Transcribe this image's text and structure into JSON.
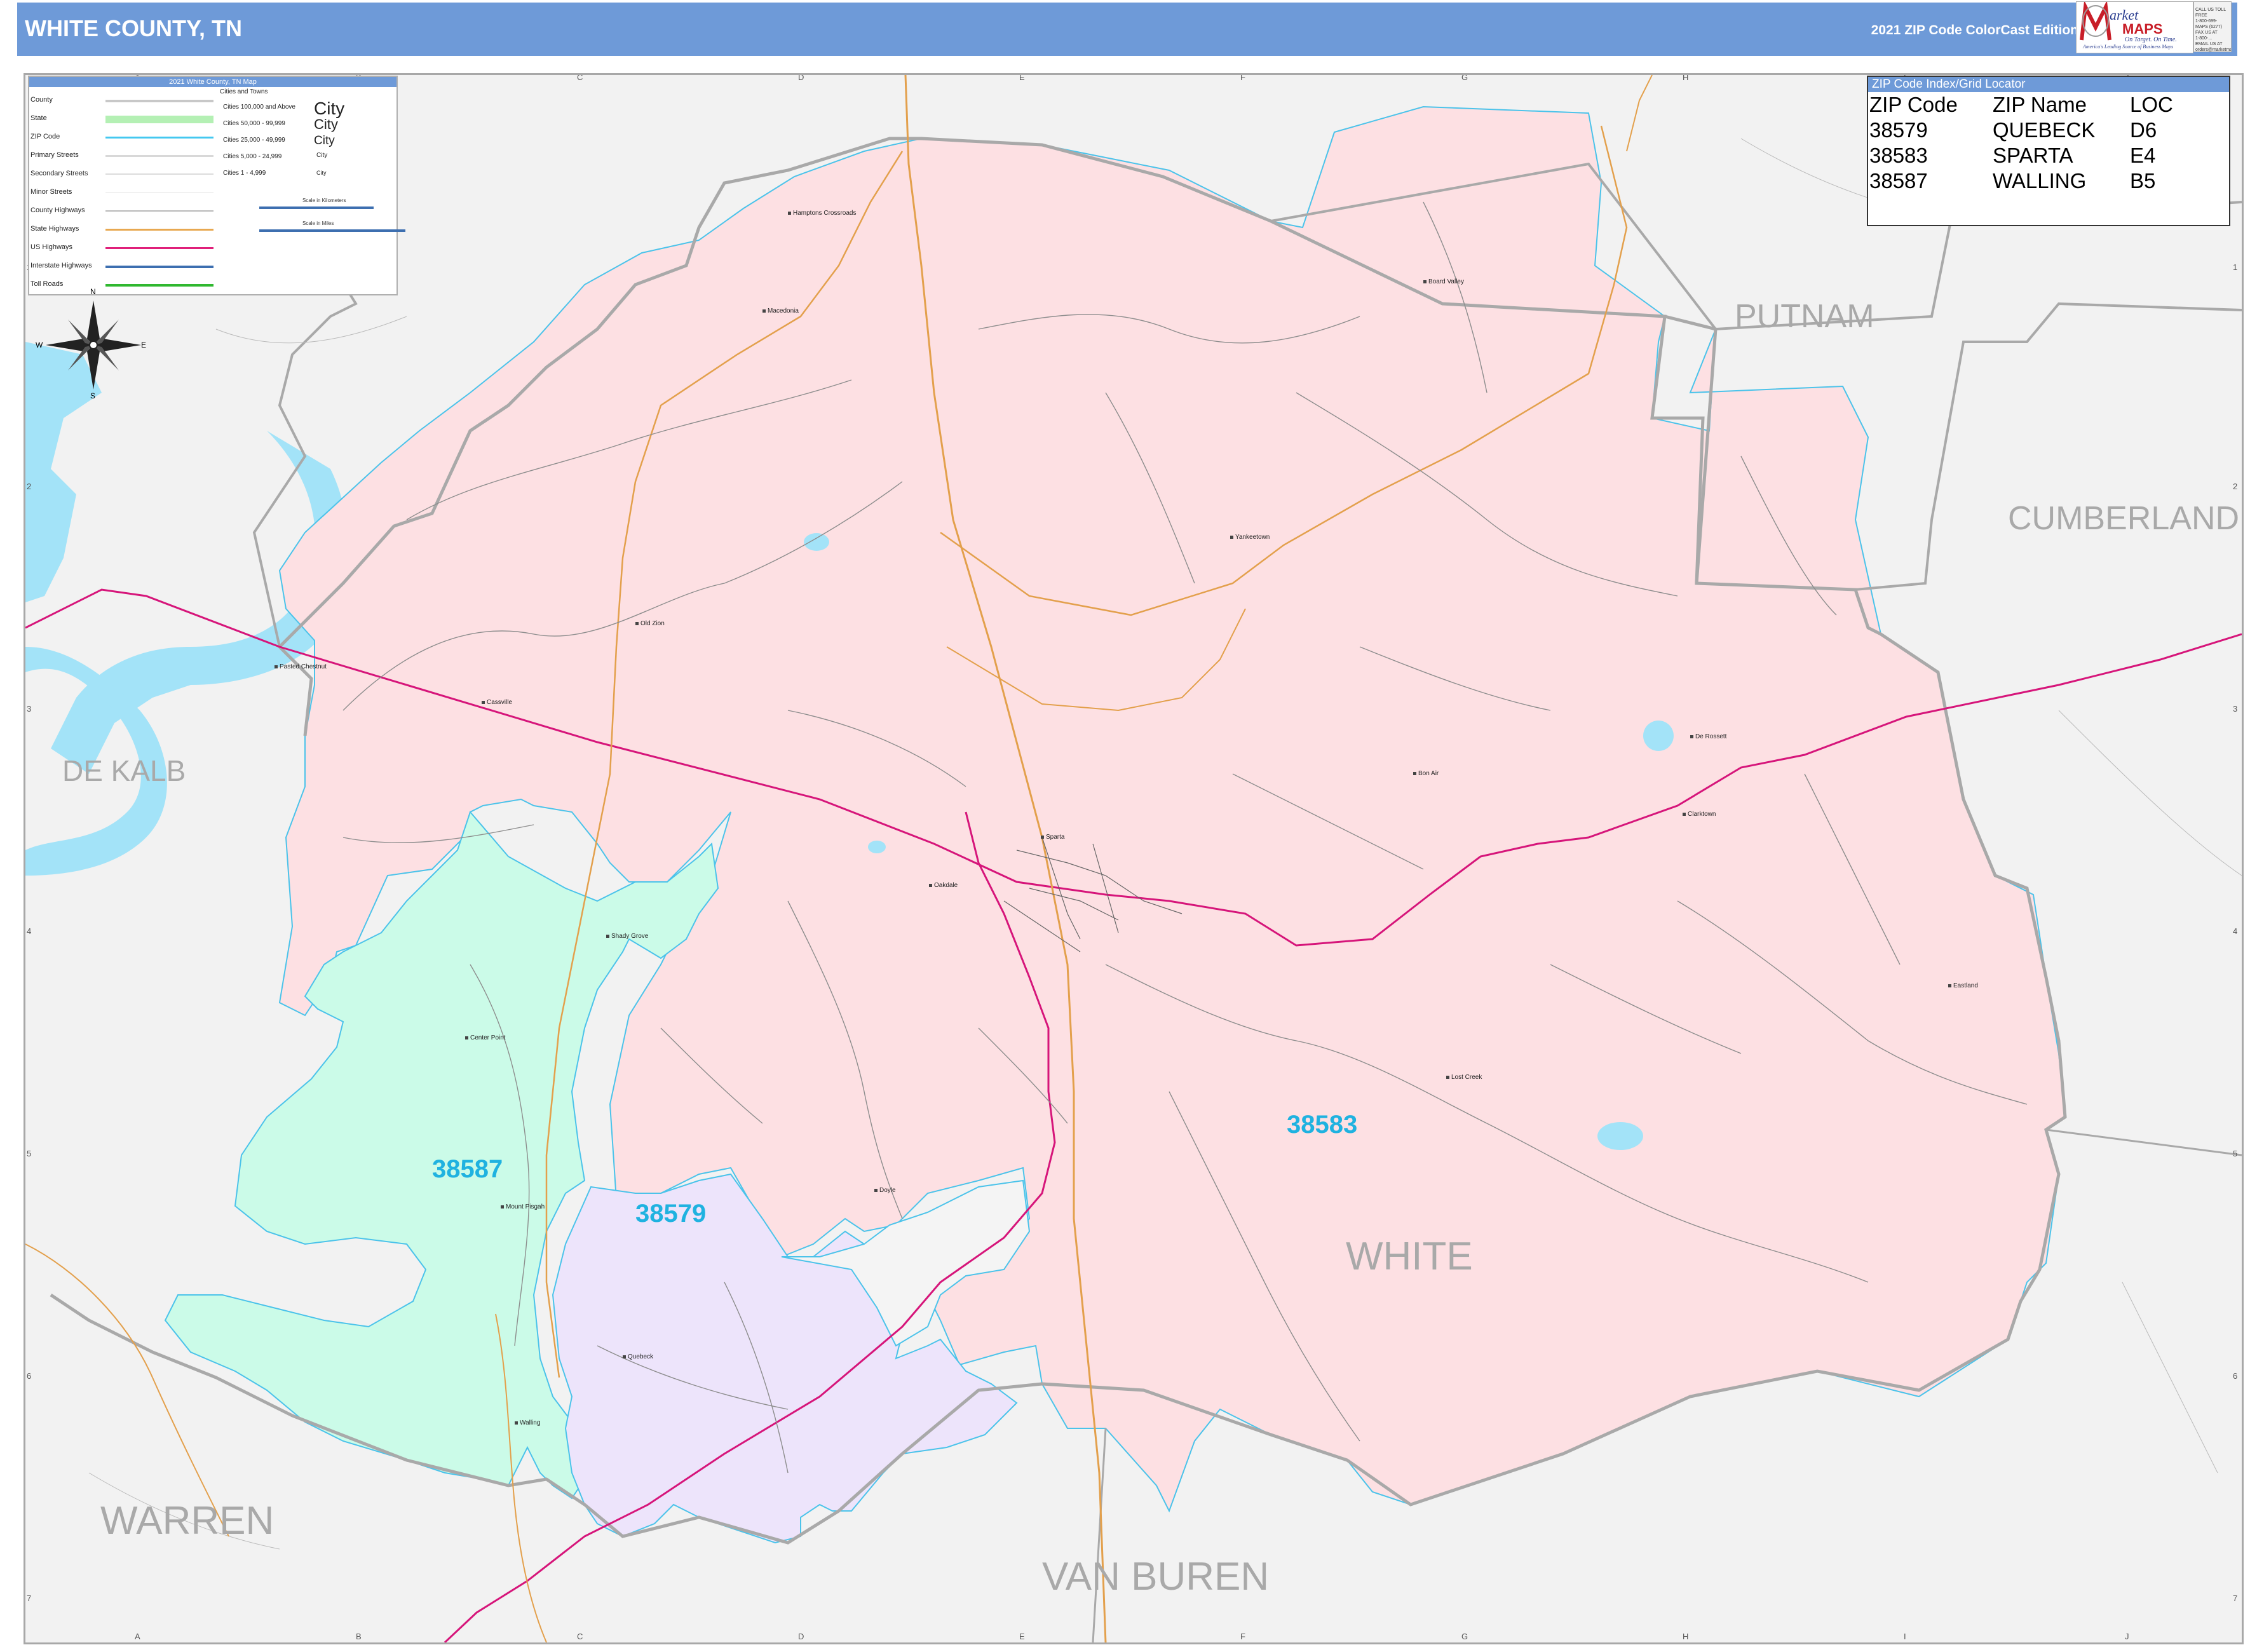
{
  "header": {
    "title": "WHITE COUNTY, TN",
    "edition": "2021 ZIP Code ColorCast Edition",
    "logo": {
      "word_market": "arket",
      "word_maps": "MAPS",
      "tagline": "On Target.  On Time.",
      "subtagline": "America's Leading Source of Business Maps",
      "contact_lines": [
        "CALL US TOLL FREE",
        "1-800-699-MAPS (6277)",
        "FAX US AT",
        "1-800-...",
        "EMAIL US AT",
        "orders@marketmaps.com"
      ]
    }
  },
  "grid": {
    "columns": [
      "A",
      "B",
      "C",
      "D",
      "E",
      "F",
      "G",
      "H",
      "I",
      "J"
    ],
    "rows": [
      "1",
      "2",
      "3",
      "4",
      "5",
      "6",
      "7"
    ]
  },
  "legend": {
    "title": "2021 White County, TN Map",
    "items": [
      {
        "label": "County",
        "color": "#c8c8c8"
      },
      {
        "label": "State",
        "color": "#b4f0b4"
      },
      {
        "label": "ZIP Code",
        "color": "#44c8f0"
      },
      {
        "label": "Primary Streets",
        "color": "#d8d8d8"
      },
      {
        "label": "Secondary Streets",
        "color": "#e4e4e4"
      },
      {
        "label": "Minor Streets",
        "color": "#eeeeee"
      },
      {
        "label": "County Highways",
        "color": "#b8b8b8"
      },
      {
        "label": "State Highways",
        "color": "#e8a850"
      },
      {
        "label": "US Highways",
        "color": "#e0207a"
      },
      {
        "label": "Interstate Highways",
        "color": "#3d6fb0"
      },
      {
        "label": "Toll Roads",
        "color": "#30b830"
      }
    ],
    "cities_heading": "Cities and Towns",
    "city_classes": [
      "Cities 100,000 and Above",
      "Cities 50,000 - 99,999",
      "Cities 25,000 - 49,999",
      "Cities 5,000 - 24,999",
      "Cities 1 - 4,999"
    ],
    "city_sample": "City",
    "scale_km_label": "Scale in Kilometers",
    "scale_mi_label": "Scale in Miles",
    "scale_km_ticks": [
      "0",
      "1",
      "2",
      "3"
    ],
    "scale_mi_ticks": [
      "0",
      "1",
      "2",
      "3"
    ]
  },
  "compass": {
    "n": "N",
    "s": "S",
    "e": "E",
    "w": "W"
  },
  "zip_index": {
    "title": "ZIP Code Index/Grid Locator",
    "columns": [
      "ZIP Code",
      "ZIP Name",
      "LOC"
    ],
    "rows": [
      [
        "38579",
        "QUEBECK",
        "D6"
      ],
      [
        "38583",
        "SPARTA",
        "E4"
      ],
      [
        "38587",
        "WALLING",
        "B5"
      ]
    ]
  },
  "counties": [
    "PUTNAM",
    "CUMBERLAND",
    "DE KALB",
    "WARREN",
    "VAN BUREN",
    "WHITE"
  ],
  "zip_labels": [
    "38583",
    "38587",
    "38579"
  ],
  "places": [
    "Hamptons Crossroads",
    "Board Valley",
    "Macedonia",
    "Yankeetown",
    "Old Zion",
    "Pasted Chestnut",
    "Cassville",
    "Sparta",
    "Bon Air",
    "De Rossett",
    "Clarktown",
    "Oakdale",
    "Shady Grove",
    "Center Point",
    "Eastland",
    "Lost Creek",
    "Doyle",
    "Mount Pisgah",
    "Quebeck",
    "Walling"
  ],
  "colors": {
    "zip_38583": "#fde0e3",
    "zip_38587": "#cbfbe8",
    "zip_38579": "#ede4fb",
    "water": "#a3e3f8",
    "outside": "#f2f2f2",
    "zip_boundary": "#4bc3ea",
    "county_boundary": "#a9a9a9",
    "us_highway": "#d6157a",
    "state_highway": "#e3a04c",
    "header": "#6e9ad8"
  }
}
